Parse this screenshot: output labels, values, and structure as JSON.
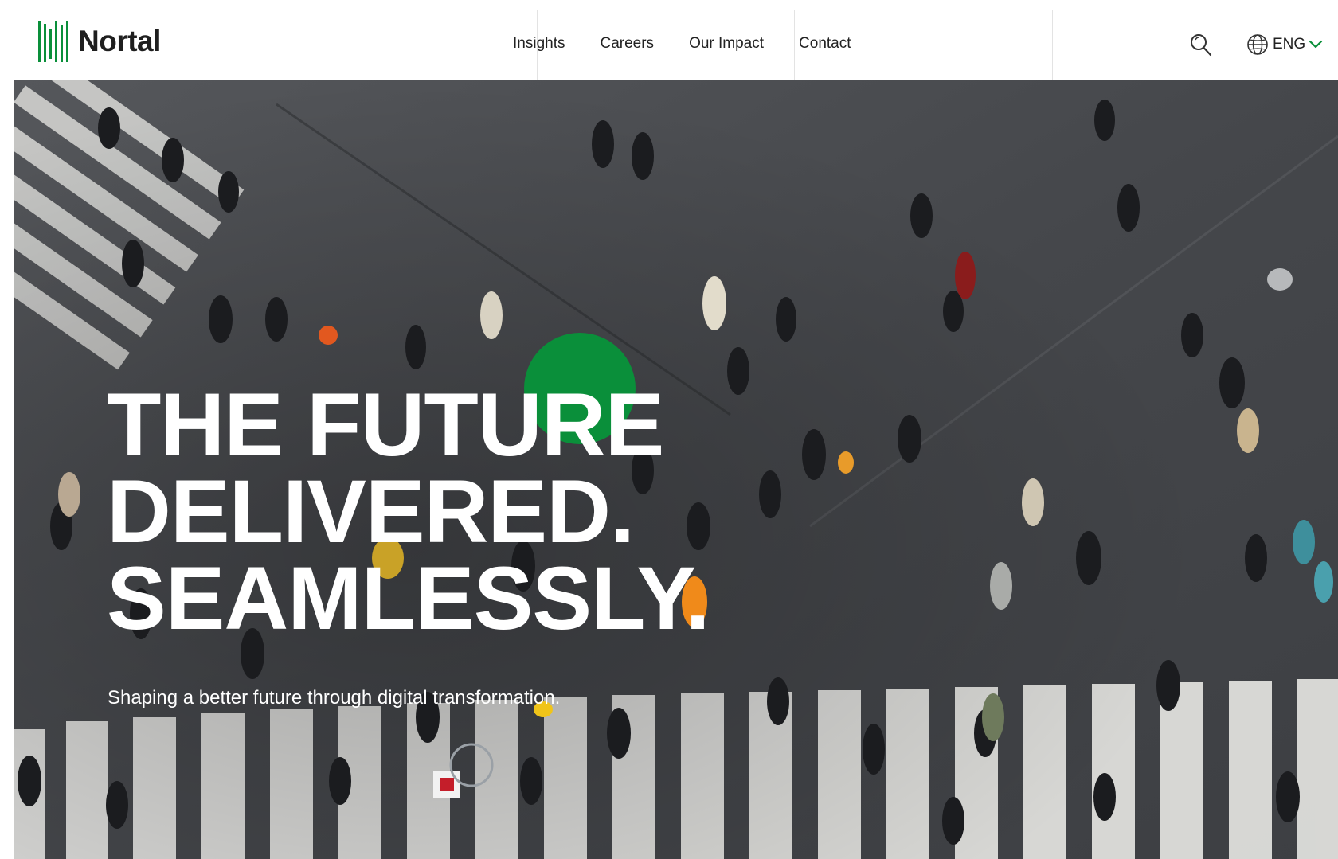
{
  "header": {
    "logo_text": "Nortal",
    "nav": [
      "Insights",
      "Careers",
      "Our Impact",
      "Contact"
    ],
    "language": "ENG"
  },
  "hero": {
    "headline": [
      "THE FUTURE",
      "DELIVERED.",
      "SEAMLESSLY."
    ],
    "subtitle": "Shaping a better future through digital transformation."
  },
  "colors": {
    "brand_green": "#0a8f3a",
    "text_dark": "#222222",
    "hero_text": "#ffffff"
  }
}
